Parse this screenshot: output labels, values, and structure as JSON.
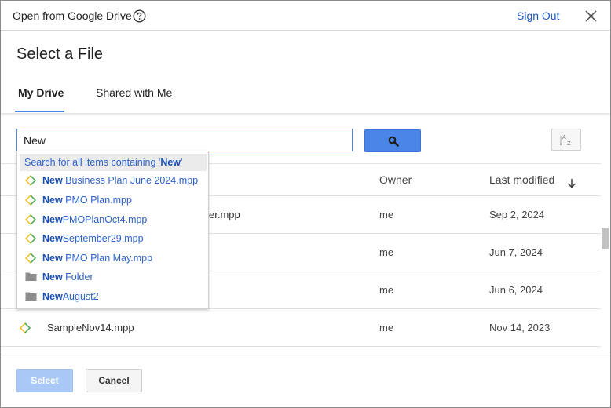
{
  "titlebar": {
    "title": "Open from Google Drive",
    "help_icon": "help-circle-icon",
    "sign_out": "Sign Out",
    "close_icon": "close-icon"
  },
  "dialog": {
    "heading": "Select a File",
    "tabs": [
      {
        "label": "My Drive",
        "active": true
      },
      {
        "label": "Shared with Me",
        "active": false
      }
    ]
  },
  "search": {
    "value": "New",
    "button_icon": "search-icon",
    "sort_icon": "sort-az-icon"
  },
  "table": {
    "columns": {
      "owner": "Owner",
      "modified": "Last modified"
    },
    "sort_icon": "arrow-down-icon",
    "rows": [
      {
        "name": "...er.mpp",
        "visible_fragment": "er.mpp",
        "owner": "me",
        "modified": "Sep 2, 2024"
      },
      {
        "name": "",
        "owner": "me",
        "modified": "Jun 7, 2024"
      },
      {
        "name": "",
        "owner": "me",
        "modified": "Jun 6, 2024"
      },
      {
        "name": "SampleNov14.mpp",
        "owner": "me",
        "modified": "Nov 14, 2023",
        "icon": "project-file-icon"
      }
    ]
  },
  "dropdown": {
    "search_all_prefix": "Search for all items containing '",
    "search_all_term": "New",
    "search_all_suffix": "'",
    "items": [
      {
        "match": "New",
        "rest": " Business Plan June 2024.mpp",
        "icon": "project-file-icon"
      },
      {
        "match": "New",
        "rest": " PMO Plan.mpp",
        "icon": "project-file-icon"
      },
      {
        "match": "New",
        "rest": "PMOPlanOct4.mpp",
        "icon": "project-file-icon"
      },
      {
        "match": "New",
        "rest": "September29.mpp",
        "icon": "project-file-icon"
      },
      {
        "match": "New",
        "rest": " PMO Plan May.mpp",
        "icon": "project-file-icon"
      },
      {
        "match": "New",
        "rest": " Folder",
        "icon": "folder-icon"
      },
      {
        "match": "New",
        "rest": "August2",
        "icon": "folder-icon"
      }
    ]
  },
  "footer": {
    "select_label": "Select",
    "cancel_label": "Cancel"
  },
  "colors": {
    "accent": "#4a86e8",
    "link": "#1a56c4",
    "select_disabled": "#a9c8f5"
  }
}
